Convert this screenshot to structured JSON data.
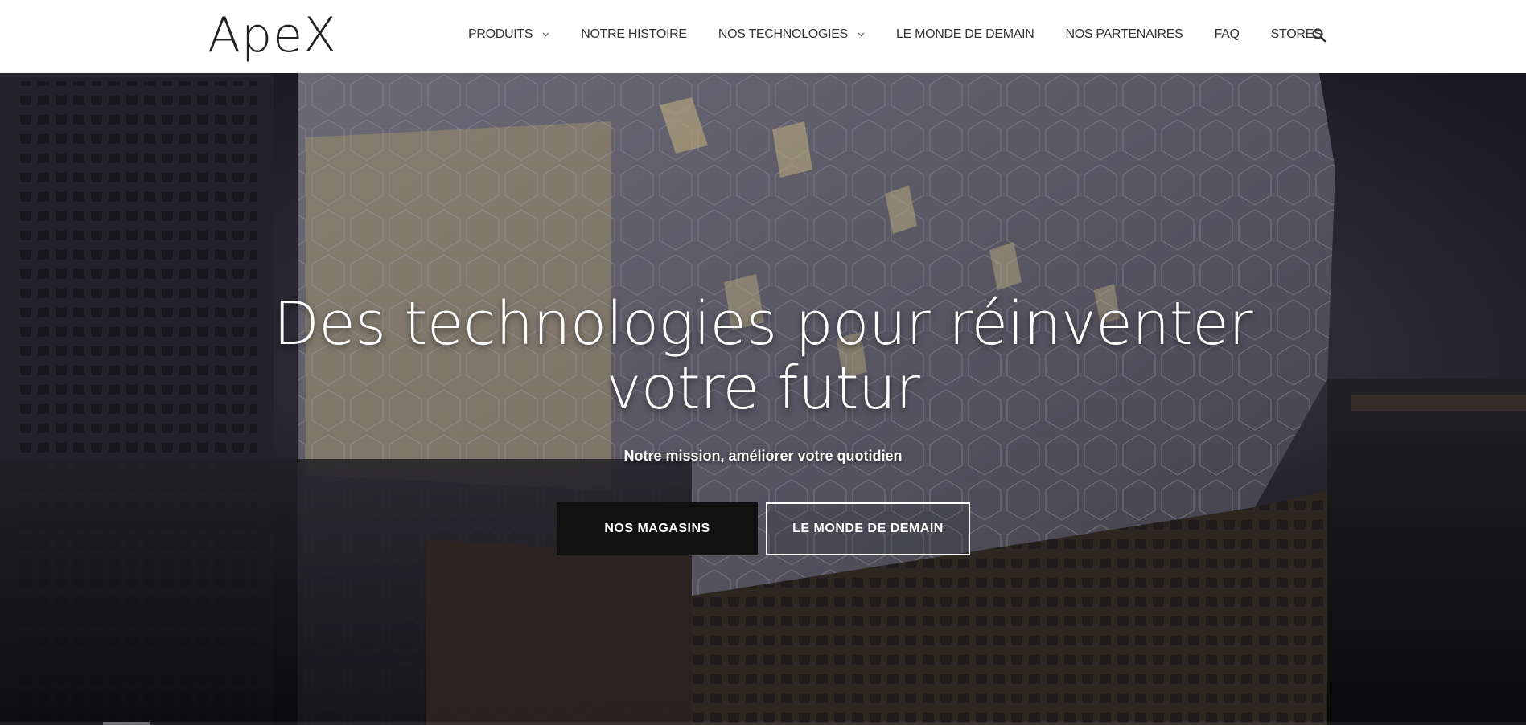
{
  "brand": {
    "logo_text": "ApeX"
  },
  "nav": {
    "items": [
      {
        "label": "PRODUITS",
        "has_dropdown": true
      },
      {
        "label": "NOTRE HISTOIRE",
        "has_dropdown": false
      },
      {
        "label": "NOS TECHNOLOGIES",
        "has_dropdown": true
      },
      {
        "label": "LE MONDE DE DEMAIN",
        "has_dropdown": false
      },
      {
        "label": "NOS PARTENAIRES",
        "has_dropdown": false
      },
      {
        "label": "FAQ",
        "has_dropdown": false
      },
      {
        "label": "STORES",
        "has_dropdown": false
      }
    ],
    "search_icon": "search-icon"
  },
  "hero": {
    "title_line1": "Des technologies pour réinventer",
    "title_line2": "votre futur",
    "subtitle": "Notre mission, améliorer votre quotidien",
    "primary_button": "NOS MAGASINS",
    "secondary_button": "LE MONDE DE DEMAIN"
  },
  "colors": {
    "header_bg": "#ffffff",
    "nav_text": "#333333",
    "primary_button_bg": "#111111",
    "hero_text": "#ffffff"
  }
}
